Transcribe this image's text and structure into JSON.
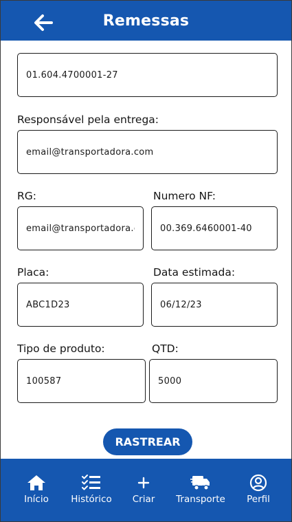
{
  "header": {
    "title": "Remessas",
    "back_icon": "arrow-left-icon"
  },
  "form": {
    "top_field": {
      "value": "01.604.4700001-27"
    },
    "responsavel": {
      "label": "Responsável pela entrega:",
      "value": "email@transportadora.com"
    },
    "rg": {
      "label": "RG:",
      "value": "email@transportadora.com"
    },
    "numero_nf": {
      "label": "Numero NF:",
      "value": "00.369.6460001-40"
    },
    "placa": {
      "label": "Placa:",
      "value": "ABC1D23"
    },
    "data_estimada": {
      "label": "Data estimada:",
      "value": "06/12/23"
    },
    "tipo_produto": {
      "label": "Tipo de produto:",
      "value": "100587"
    },
    "qtd": {
      "label": "QTD:",
      "value": "5000"
    }
  },
  "actions": {
    "rastrear_label": "RASTREAR"
  },
  "bottom_nav": {
    "items": [
      {
        "label": "Início",
        "icon": "home-icon"
      },
      {
        "label": "Histórico",
        "icon": "checklist-icon"
      },
      {
        "label": "Criar",
        "icon": "plus-icon"
      },
      {
        "label": "Transporte",
        "icon": "truck-icon"
      },
      {
        "label": "Perfil",
        "icon": "user-circle-icon"
      }
    ]
  },
  "colors": {
    "primary": "#1557b0",
    "background": "#ffffff",
    "border": "#1a1a1a"
  }
}
